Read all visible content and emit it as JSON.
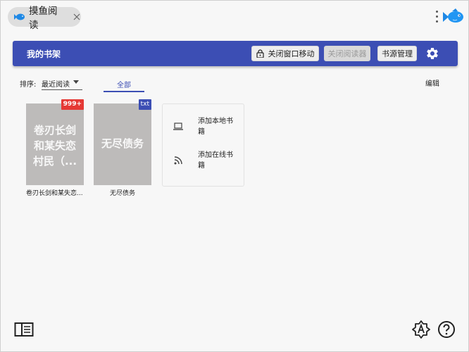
{
  "app": {
    "tab_label": "摸鱼阅读"
  },
  "header": {
    "title": "我的书架",
    "btn_lock_move": "关闭窗口移动",
    "btn_close_reader": "关闭阅读器",
    "btn_source_manage": "书源管理"
  },
  "toolbar": {
    "sort_label": "排序:",
    "sort_value": "最近阅读",
    "tab_all": "全部",
    "edit": "编辑"
  },
  "books": [
    {
      "cover_text": "卷刃长剑和某失恋村民（...",
      "badge": "999+",
      "title": "卷刃长剑和某失恋..."
    },
    {
      "cover_text": "无尽债务",
      "badge": "txt",
      "title": "无尽债务"
    }
  ],
  "add_panel": {
    "add_local": "添加本地书籍",
    "add_online": "添加在线书籍"
  },
  "colors": {
    "accent": "#3c4eb4",
    "badge_red": "#e53935",
    "cover_gray": "#bdbbba",
    "background": "#f7f7f7"
  },
  "icons": [
    "fish-logo-icon",
    "close-icon",
    "more-vert-icon",
    "brand-fish-icon",
    "lock-icon",
    "gear-icon",
    "laptop-icon",
    "rss-icon",
    "book-open-icon",
    "font-size-icon",
    "help-icon"
  ]
}
